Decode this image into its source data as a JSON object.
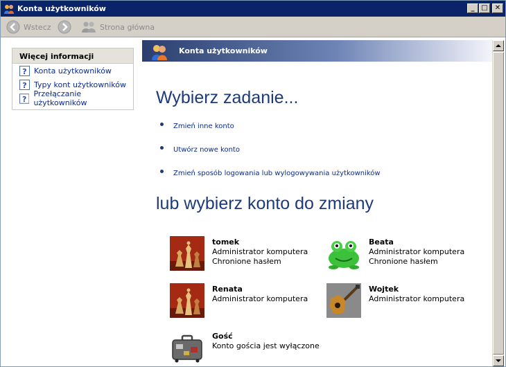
{
  "window": {
    "title": "Konta użytkowników",
    "minimize": "_",
    "maximize": "□",
    "close": "✕"
  },
  "toolbar": {
    "back_label": "Wstecz",
    "forward_label": "",
    "home_label": "Strona główna"
  },
  "sidebar": {
    "header": "Więcej informacji",
    "links": [
      {
        "label": "Konta użytkowników",
        "icon": "help-icon"
      },
      {
        "label": "Typy kont użytkowników",
        "icon": "help-icon"
      },
      {
        "label": "Przełączanie użytkowników",
        "icon": "help-icon"
      }
    ]
  },
  "banner": {
    "title": "Konta użytkowników",
    "icon": "users-icon"
  },
  "main": {
    "heading_tasks": "Wybierz zadanie...",
    "tasks": [
      "Zmień inne konto",
      "Utwórz nowe konto",
      "Zmień sposób logowania lub wylogowywania użytkowników"
    ],
    "heading_accounts": "lub wybierz konto do zmiany",
    "accounts": [
      {
        "name": "tomek",
        "line1": "Administrator komputera",
        "line2": "Chronione hasłem",
        "picture": "chess-pieces"
      },
      {
        "name": "Beata",
        "line1": "Administrator komputera",
        "line2": "Chronione hasłem",
        "picture": "green-frog"
      },
      {
        "name": "Renata",
        "line1": "Administrator komputera",
        "line2": "",
        "picture": "chess-pieces"
      },
      {
        "name": "Wojtek",
        "line1": "Administrator komputera",
        "line2": "",
        "picture": "electric-guitar"
      },
      {
        "name": "Gość",
        "line1": "Konto gościa jest wyłączone",
        "line2": "",
        "picture": "suitcase"
      }
    ]
  },
  "colors": {
    "titlebar": "#0a246a",
    "heading": "#1d3a7a",
    "link": "#0b2a8c",
    "toolbar": "#d4d0c8"
  }
}
